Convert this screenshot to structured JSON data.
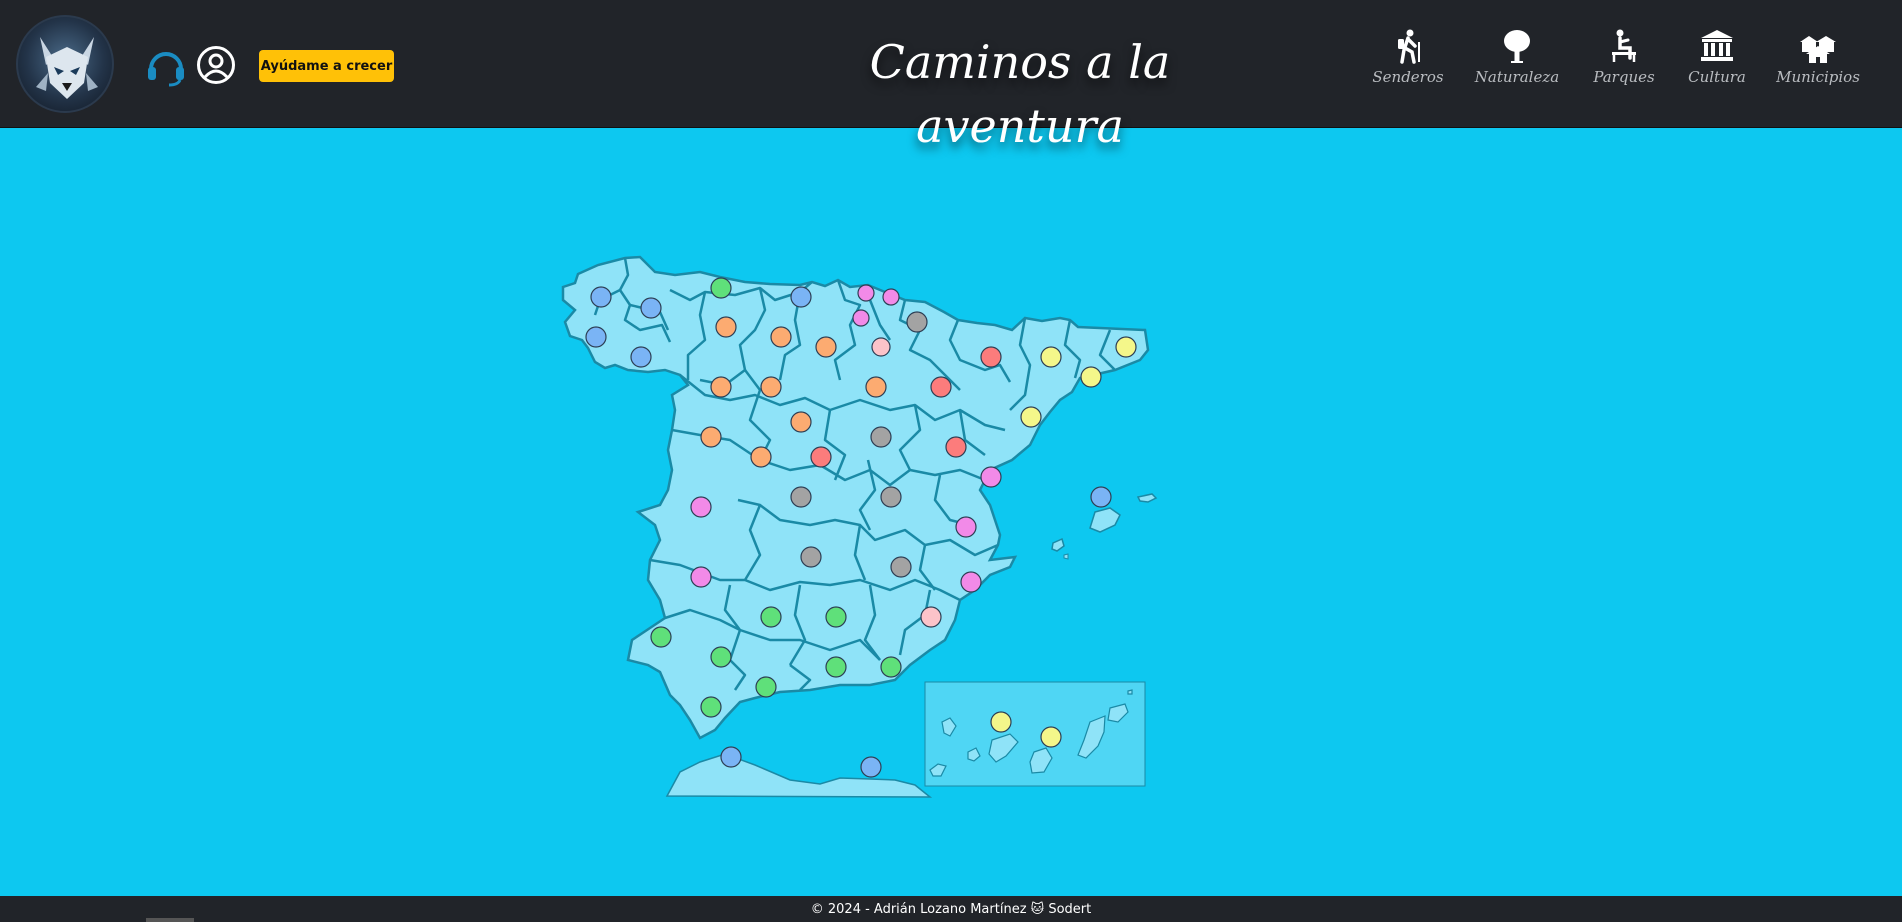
{
  "header": {
    "title": "Caminos a la aventura",
    "help_button": "Ayúdame a crecer",
    "nav": [
      {
        "label": "Senderos",
        "icon": "hiker-icon"
      },
      {
        "label": "Naturaleza",
        "icon": "tree-icon"
      },
      {
        "label": "Parques",
        "icon": "park-bench-icon"
      },
      {
        "label": "Cultura",
        "icon": "museum-icon"
      },
      {
        "label": "Municipios",
        "icon": "houses-icon"
      }
    ]
  },
  "map": {
    "colors": {
      "ocean": "#0dc8f0",
      "land": "#8fe3f8",
      "border": "#1a8aa6",
      "green": "#5fe07a",
      "blue": "#7ab4f5",
      "pink": "#f28ae8",
      "orange": "#fcab71",
      "grey": "#a3a3a3",
      "red": "#fc7c7c",
      "yellow": "#f4f78a",
      "light_pink": "#fcc3c9"
    }
  },
  "footer": {
    "text": "© 2024 - Adrián Lozano Martínez 🐱 Sodert"
  }
}
